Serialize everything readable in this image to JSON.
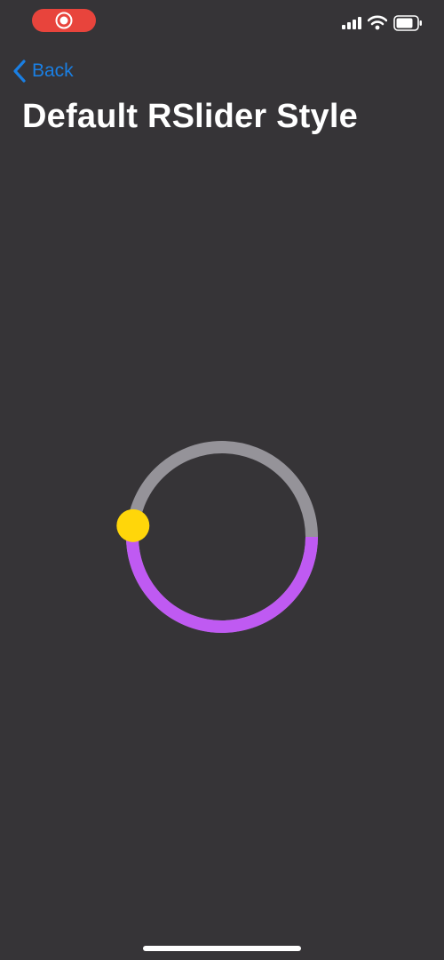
{
  "nav": {
    "back_label": "Back",
    "title": "Default RSlider Style"
  },
  "status_bar": {
    "icons": [
      "record-icon",
      "cellular-signal-icon",
      "wifi-icon",
      "battery-icon"
    ],
    "record_color": "#e8443c"
  },
  "slider": {
    "style": "circular",
    "value": 0.52,
    "track_color": "#959399",
    "progress_color": "#bf5af2",
    "thumb_color": "#ffd60a"
  },
  "colors": {
    "background": "#363437",
    "accent": "#1a7fe3",
    "title": "#ffffff"
  }
}
